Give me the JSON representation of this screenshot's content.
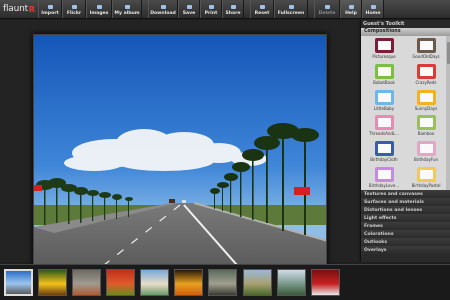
{
  "app": {
    "name": "flaunt",
    "name_suffix": "R"
  },
  "toolbar": {
    "buttons": [
      {
        "label": "Import",
        "icon": "import-icon"
      },
      {
        "label": "Flickr",
        "icon": "flickr-icon"
      },
      {
        "label": "Images",
        "icon": "images-icon"
      },
      {
        "label": "My album",
        "icon": "album-icon"
      },
      {
        "label": "Download",
        "icon": "download-icon"
      },
      {
        "label": "Save",
        "icon": "save-icon"
      },
      {
        "label": "Print",
        "icon": "print-icon"
      },
      {
        "label": "Share",
        "icon": "share-icon"
      },
      {
        "label": "Reset",
        "icon": "reset-icon"
      },
      {
        "label": "Fullscreen",
        "icon": "fullscreen-icon"
      },
      {
        "label": "Delete",
        "icon": "delete-icon"
      },
      {
        "label": "Help",
        "icon": "help-icon"
      },
      {
        "label": "Home",
        "icon": "home-icon"
      }
    ]
  },
  "panel": {
    "title": "Guest's Toolkit",
    "open_category": "Compositions",
    "frames": [
      {
        "label": "Picturesque",
        "color": "#7a1f3a"
      },
      {
        "label": "GoodOldDays",
        "color": "#6b5a4a"
      },
      {
        "label": "BabotBook",
        "color": "#7bc043"
      },
      {
        "label": "CrazyReds",
        "color": "#d93b3b"
      },
      {
        "label": "LittleBaby",
        "color": "#6fb7e8"
      },
      {
        "label": "SunnyDays",
        "color": "#f0b323"
      },
      {
        "label": "ThreadsAndL...",
        "color": "#e98bb0"
      },
      {
        "label": "Bamboo",
        "color": "#9bbf5a"
      },
      {
        "label": "BirthdayCloth",
        "color": "#3a5da8"
      },
      {
        "label": "BirthdayFun",
        "color": "#e7a5c6"
      },
      {
        "label": "BirthdayLove...",
        "color": "#c58be3"
      },
      {
        "label": "BirthdayPastel",
        "color": "#f2c95a"
      }
    ],
    "categories": [
      "Textures and canvases",
      "Surfaces and materials",
      "Distortions and lenses",
      "Light effects",
      "Frames",
      "Colorations",
      "Outlooks",
      "Overlays"
    ]
  },
  "filmstrip": {
    "thumbs": [
      {
        "name": "thumb-highway",
        "colors": [
          "#2b6fc9",
          "#9cc4ee",
          "#5a5a5a"
        ],
        "selected": true
      },
      {
        "name": "thumb-sunflower",
        "colors": [
          "#2e5a1a",
          "#f4c21a",
          "#6a3d10"
        ]
      },
      {
        "name": "thumb-house",
        "colors": [
          "#6e6a62",
          "#a09a90",
          "#b05a30"
        ]
      },
      {
        "name": "thumb-berries",
        "colors": [
          "#c0301a",
          "#e05a2a",
          "#6a8a20"
        ]
      },
      {
        "name": "thumb-beach",
        "colors": [
          "#78a8d8",
          "#e8ddc8",
          "#6a9a6a"
        ]
      },
      {
        "name": "thumb-flower",
        "colors": [
          "#2a1a08",
          "#e8a020",
          "#d06010"
        ]
      },
      {
        "name": "thumb-animal",
        "colors": [
          "#5a6a5a",
          "#a0a090",
          "#3a3a30"
        ]
      },
      {
        "name": "thumb-field",
        "colors": [
          "#9ab8d8",
          "#a8a070",
          "#4a6a2a"
        ]
      },
      {
        "name": "thumb-lake",
        "colors": [
          "#cfdce8",
          "#7a9a8a",
          "#3a5a3a"
        ]
      },
      {
        "name": "thumb-car",
        "colors": [
          "#7a1010",
          "#c82020",
          "#e8e8e8"
        ]
      }
    ]
  }
}
